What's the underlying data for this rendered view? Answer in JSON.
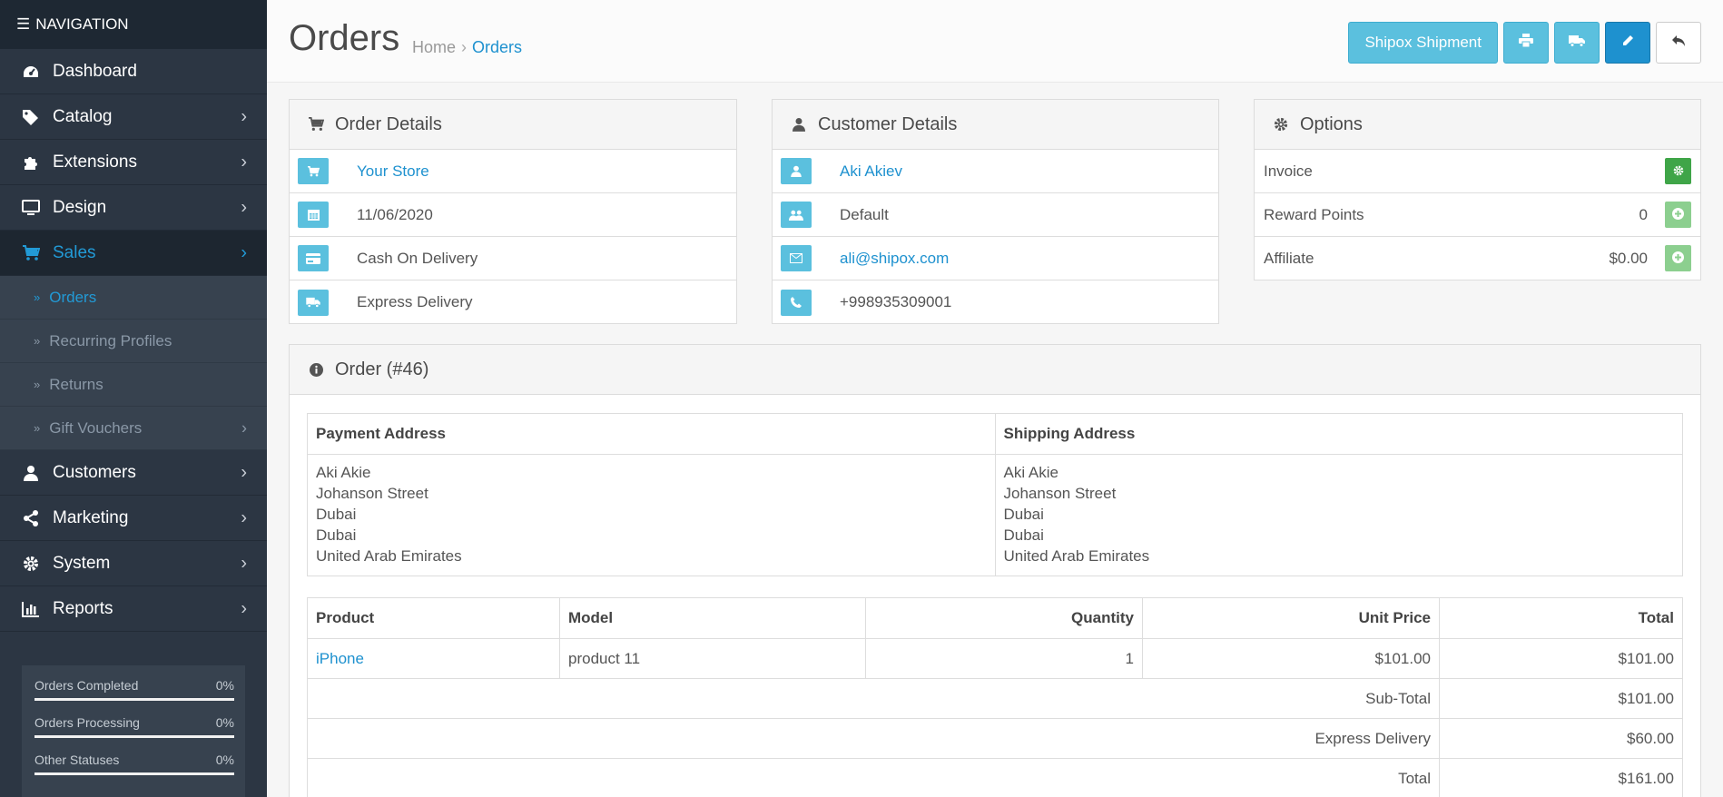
{
  "sidebar": {
    "header": "NAVIGATION",
    "items": [
      {
        "label": "Dashboard",
        "icon": "dashboard-icon"
      },
      {
        "label": "Catalog",
        "icon": "tags-icon"
      },
      {
        "label": "Extensions",
        "icon": "puzzle-icon"
      },
      {
        "label": "Design",
        "icon": "monitor-icon"
      },
      {
        "label": "Sales",
        "icon": "cart-icon"
      }
    ],
    "sales_sub": [
      {
        "label": "Orders"
      },
      {
        "label": "Recurring Profiles"
      },
      {
        "label": "Returns"
      },
      {
        "label": "Gift Vouchers"
      }
    ],
    "items2": [
      {
        "label": "Customers",
        "icon": "user-icon"
      },
      {
        "label": "Marketing",
        "icon": "share-icon"
      },
      {
        "label": "System",
        "icon": "cog-icon"
      },
      {
        "label": "Reports",
        "icon": "bar-chart-icon"
      }
    ],
    "stats": [
      {
        "label": "Orders Completed",
        "value": "0%"
      },
      {
        "label": "Orders Processing",
        "value": "0%"
      },
      {
        "label": "Other Statuses",
        "value": "0%"
      }
    ]
  },
  "header": {
    "title": "Orders",
    "breadcrumb": [
      "Home",
      "Orders"
    ],
    "breadcrumb_sep": "›",
    "shipment_button": "Shipox Shipment"
  },
  "order_details": {
    "title": "Order Details",
    "store": "Your Store",
    "date": "11/06/2020",
    "payment": "Cash On Delivery",
    "shipping": "Express Delivery"
  },
  "customer_details": {
    "title": "Customer Details",
    "name": "Aki Akiev",
    "group": "Default",
    "email": "ali@shipox.com",
    "phone": "+998935309001"
  },
  "options": {
    "title": "Options",
    "invoice_label": "Invoice",
    "reward_label": "Reward Points",
    "reward_value": "0",
    "affiliate_label": "Affiliate",
    "affiliate_value": "$0.00"
  },
  "order": {
    "title": "Order (#46)",
    "payment_address_header": "Payment Address",
    "shipping_address_header": "Shipping Address",
    "payment_address": [
      "Aki Akie",
      "Johanson Street",
      "Dubai",
      "Dubai",
      "United Arab Emirates"
    ],
    "shipping_address": [
      "Aki Akie",
      "Johanson Street",
      "Dubai",
      "Dubai",
      "United Arab Emirates"
    ],
    "columns": [
      "Product",
      "Model",
      "Quantity",
      "Unit Price",
      "Total"
    ],
    "product": {
      "name": "iPhone",
      "model": "product 11",
      "quantity": "1",
      "unit_price": "$101.00",
      "total": "$101.00"
    },
    "totals": [
      {
        "label": "Sub-Total",
        "value": "$101.00"
      },
      {
        "label": "Express Delivery",
        "value": "$60.00"
      },
      {
        "label": "Total",
        "value": "$161.00"
      }
    ]
  },
  "colors": {
    "accent": "#1e91cf",
    "info": "#5bc0de",
    "sidebar": "#2c3643",
    "success": "#3fa548"
  }
}
